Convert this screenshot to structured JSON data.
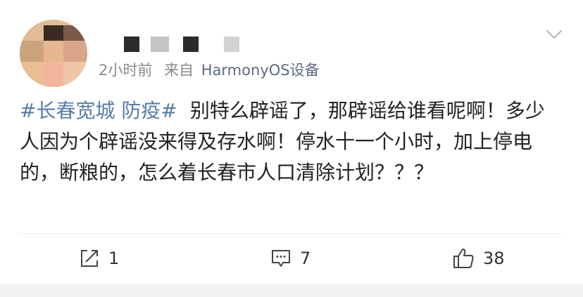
{
  "post": {
    "time": "2小时前",
    "source_prefix": "来自",
    "source_device": "HarmonyOS设备",
    "hashtag": "#长春宽城 防疫#",
    "body_text": "别特么辟谣了，那辟谣给谁看呢啊！多少人因为个辟谣没来得及存水啊！停水十一个小时，加上停电的，断粮的，怎么着长春市人口清除计划？？？"
  },
  "actions": {
    "repost_count": "1",
    "comment_count": "7",
    "like_count": "38"
  },
  "icons": {
    "more": "chevron-down-icon",
    "repost": "repost-icon",
    "comment": "comment-icon",
    "like": "thumbs-up-icon"
  },
  "colors": {
    "hashtag": "#557ca9",
    "meta": "#8a8a8a",
    "text": "#222222",
    "divider": "#ececec"
  }
}
